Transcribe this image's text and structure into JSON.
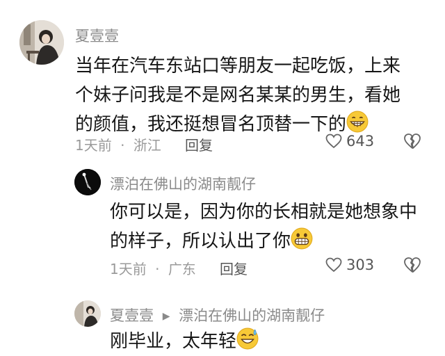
{
  "comments": [
    {
      "username": "夏壹壹",
      "lines": [
        "当年在汽车东站口等朋友一起吃饭，上来",
        "个妹子问我是不是网名某某的男生，看她",
        "的颜值，我还挺想冒名顶替一下的"
      ],
      "time": "1天前",
      "location": "浙江",
      "reply_label": "回复",
      "likes": "643",
      "emoji": "grinning-face"
    },
    {
      "username": "漂泊在佛山的湖南靓仔",
      "lines": [
        "你可以是，因为你的长相就是她想象中",
        "的样子，所以认出了你"
      ],
      "time": "1天前",
      "location": "广东",
      "reply_label": "回复",
      "likes": "303",
      "emoji": "grimacing-face"
    },
    {
      "username": "夏壹壹",
      "reply_to": "漂泊在佛山的湖南靓仔",
      "lines": [
        "刚毕业，太年轻"
      ],
      "emoji": "sweat-smile-face"
    }
  ],
  "separator": "·",
  "colors": {
    "username": "#8a8a8a",
    "meta": "#9a9a9a",
    "text": "#161616"
  }
}
